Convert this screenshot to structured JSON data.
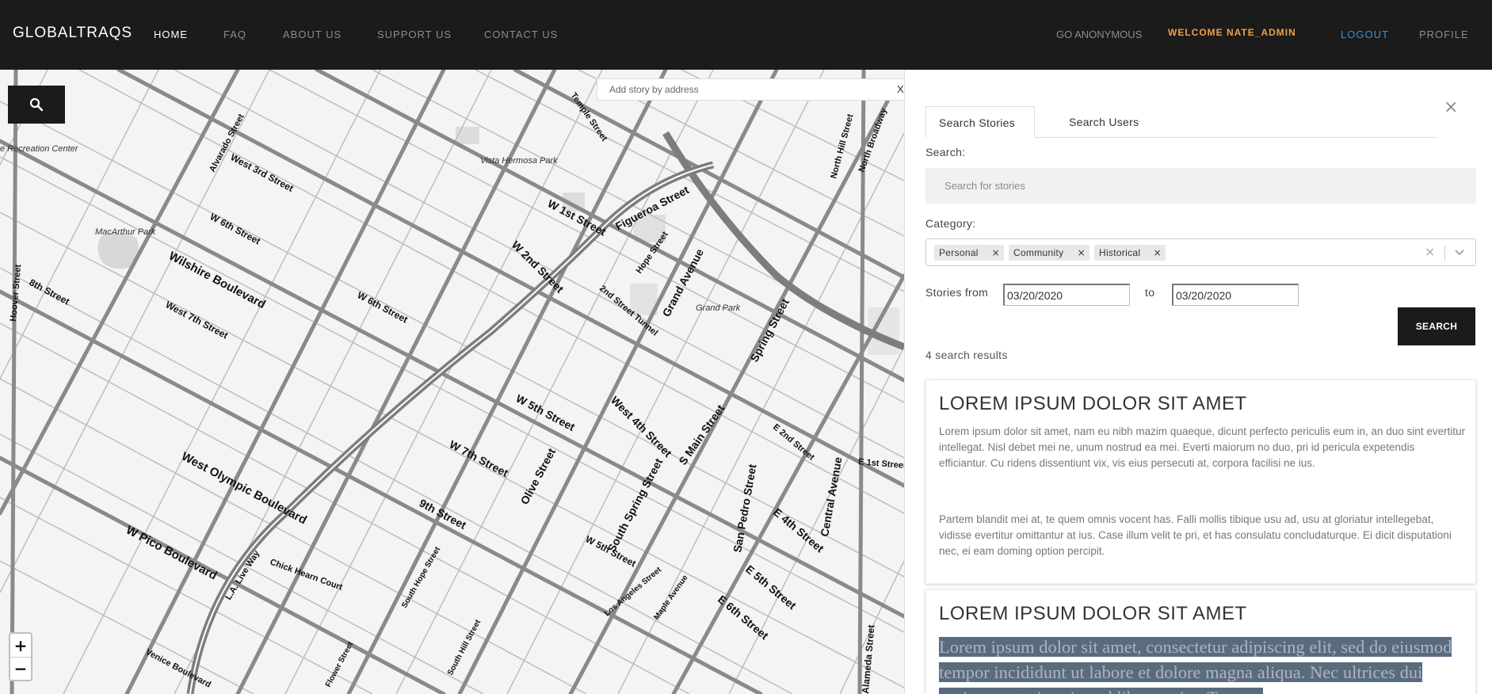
{
  "nav": {
    "brand": "GLOBALTRAQS",
    "links": [
      "HOME",
      "FAQ",
      "ABOUT US",
      "SUPPORT US",
      "CONTACT US"
    ],
    "anonymous": "GO ANONYMOUS",
    "welcome": "WELCOME NATE_ADMIN",
    "logout": "LOGOUT",
    "profile": "PROFILE"
  },
  "map": {
    "address_placeholder": "Add story by address",
    "address_clear": "X",
    "zoom_in": "+",
    "zoom_out": "−",
    "street_labels": [
      "Wilshire Boulevard",
      "West 3rd Street",
      "W 6th Street",
      "West 7th Street",
      "8th Street",
      "West Olympic Boulevard",
      "W Pico Boulevard",
      "W 1st Street",
      "W 2nd Street",
      "Figueroa Street",
      "Hope Street",
      "Grand Avenue",
      "W 5th Street",
      "West 4th Street",
      "S Main Street",
      "Spring Street",
      "W 7th Street",
      "Olive Street",
      "9th Street",
      "South Spring Street",
      "Central Avenue",
      "San Pedro Street",
      "Alvarado Street",
      "Hoover Street",
      "Temple Street",
      "North Hill Street",
      "North Broadway",
      "2nd Street Tunnel",
      "Chick Hearn Court",
      "L.A. Live Way",
      "E 1st Street",
      "E 2nd Street",
      "E 4th Street",
      "E 5th Street",
      "E 6th Street",
      "Alameda Street",
      "Los Angeles Street",
      "Maple Avenue",
      "South Hope Street",
      "South Hill Street",
      "Venice Boulevard",
      "Flower Street",
      "W 6th Street",
      "W 5th Street"
    ],
    "park_labels": [
      "MacArthur Park",
      "Vista Hermosa Park",
      "Grand Park",
      "e Recreation Center"
    ]
  },
  "panel": {
    "tabs": [
      "Search Stories",
      "Search Users"
    ],
    "close": "×",
    "search_label": "Search:",
    "search_placeholder": "Search for stories",
    "category_label": "Category:",
    "categories": [
      "Personal",
      "Community",
      "Historical"
    ],
    "chip_remove": "×",
    "stories_from_label": "Stories from",
    "to_label": "to",
    "date_from": "03/20/2020",
    "date_to": "03/20/2020",
    "search_button": "SEARCH",
    "results_count": "4 search results"
  },
  "results": [
    {
      "title": "LOREM IPSUM DOLOR SIT AMET",
      "paragraph1": "Lorem ipsum dolor sit amet, nam eu nibh mazim quaeque, dicunt perfecto periculis eum in, an duo sint evertitur intellegat. Nisl debet mei ne, unum nostrud ea mei. Everti maiorum no duo, pri id pericula expetendis efficiantur. Cu ridens dissentiunt vix, vis eius persecuti at, corpora facilisi ne ius.",
      "paragraph2": "Partem blandit mei at, te quem omnis vocent has. Falli mollis tibique usu ad, usu at gloriatur intellegebat, vidisse evertitur omittantur at ius. Case illum velit te pri, et has consulatu concludaturque. Ei dicit disputationi nec, ei eam doming option percipit."
    },
    {
      "title": "LOREM IPSUM DOLOR SIT AMET",
      "highlighted_text": "Lorem ipsum dolor sit amet, consectetur adipiscing elit, sed do eiusmod tempor incididunt ut labore et dolore magna aliqua. Nec ultrices dui sapien eget mi proin sed libero enim. Tempus"
    }
  ]
}
